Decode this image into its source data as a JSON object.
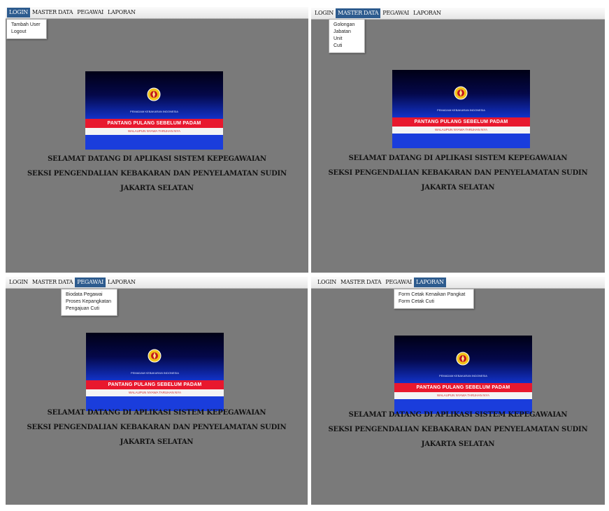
{
  "menu": [
    "LOGIN",
    "MASTER DATA",
    "PEGAWAI",
    "LAPORAN"
  ],
  "menus": {
    "login": [
      "Tambah User",
      "Logout"
    ],
    "master_data": [
      "Golongan",
      "Jabatan",
      "Unit",
      "Cuti"
    ],
    "pegawai": [
      "Biodata Pegawai",
      "Proses Kepangkatan",
      "Pengajuan Cuti"
    ],
    "laporan": [
      "Form Cetak Kenaikan Pangkat",
      "Form Cetak Cuti"
    ]
  },
  "banner": {
    "org": "PEMADAM KEBAKARAN INDONESIA",
    "motto": "PANTANG PULANG SEBELUM PADAM",
    "sub": "WALAUPUN NYAWA TARUHAN NYA"
  },
  "welcome": {
    "line1": "SELAMAT DATANG DI APLIKASI SISTEM KEPEGAWAIAN",
    "line2": "SEKSI PENGENDALIAN  KEBAKARAN DAN PENYELAMATAN SUDIN",
    "line3": "JAKARTA SELATAN"
  },
  "colors": {
    "desktop": "#7a7a7a",
    "menu_active": "#2d5b8e",
    "banner_red": "#e8182e",
    "banner_blue": "#1a3ddc"
  },
  "icons": {
    "emblem": "fire-department-emblem-icon"
  }
}
